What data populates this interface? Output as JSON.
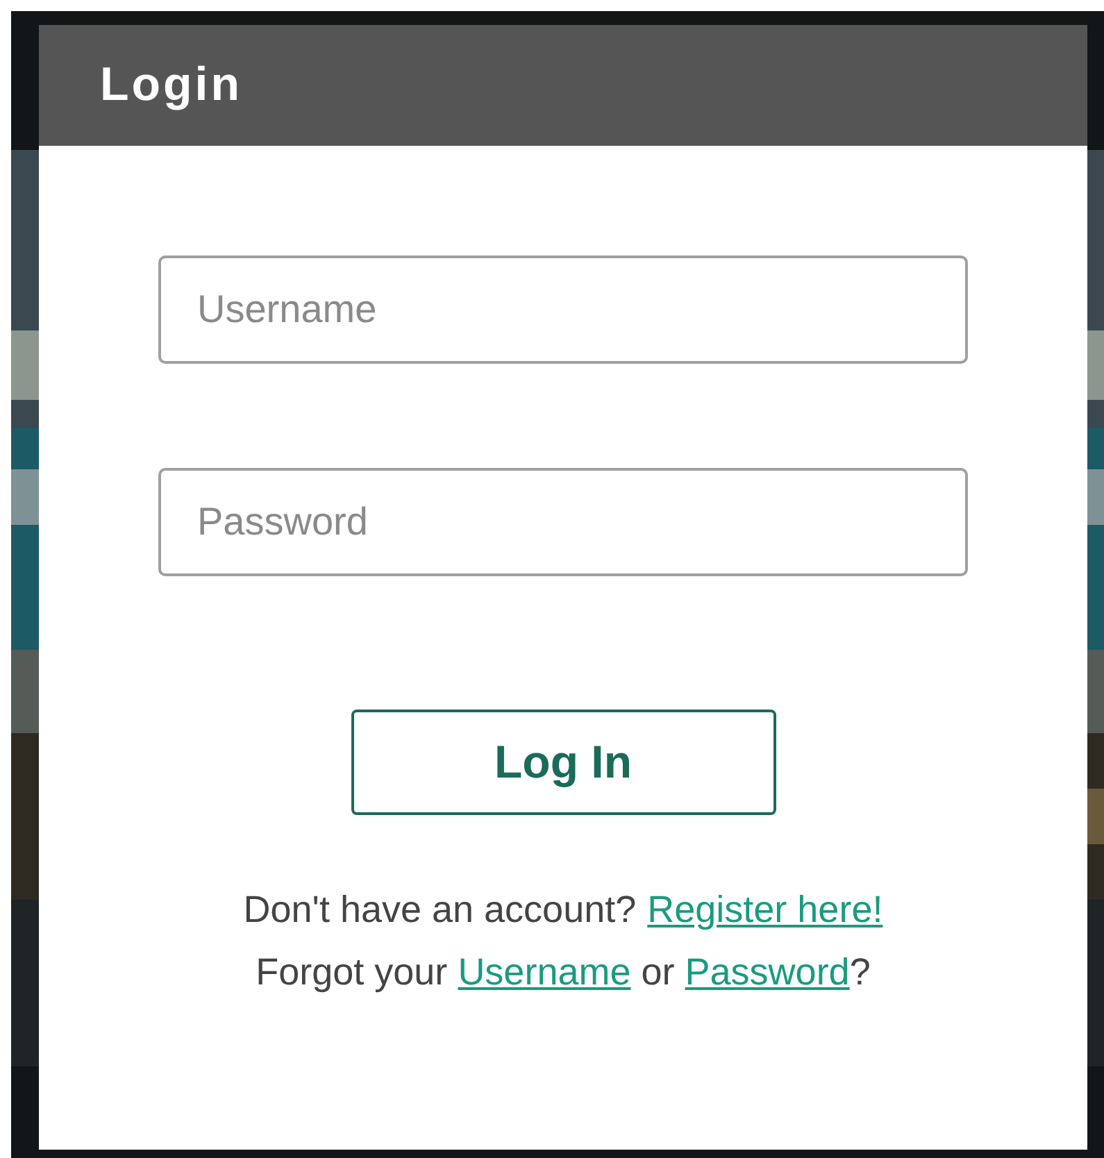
{
  "dialog": {
    "title": "Login"
  },
  "fields": [
    {
      "placeholder": "Username"
    },
    {
      "placeholder": "Password"
    }
  ],
  "submit": {
    "label": "Log In"
  },
  "register": {
    "text": "Don't have an account?",
    "link": "Register here!"
  },
  "forgot": {
    "prefix": "Forgot your",
    "link_1": "Username",
    "middle": "or",
    "link_2": "Password",
    "suffix": "?"
  }
}
